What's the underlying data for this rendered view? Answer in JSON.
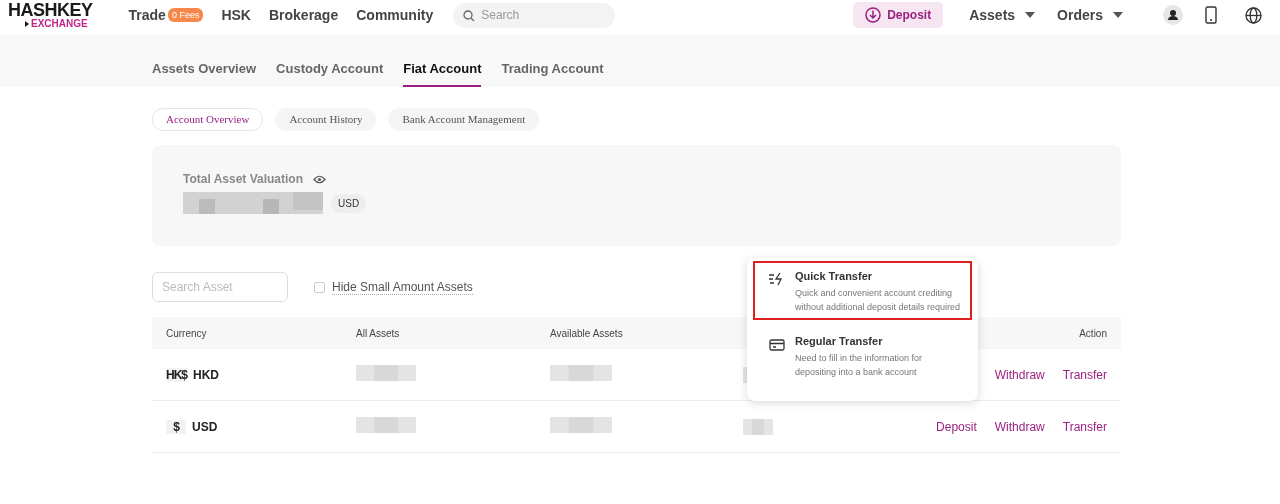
{
  "header": {
    "logo": {
      "title": "HASHKEY",
      "subtitle": "EXCHANGE"
    },
    "nav": [
      {
        "label": "Trade",
        "badge": "0 Fees"
      },
      {
        "label": "HSK"
      },
      {
        "label": "Brokerage"
      },
      {
        "label": "Community"
      }
    ],
    "search": {
      "placeholder": "Search"
    },
    "deposit_button": "Deposit",
    "menus": [
      "Assets",
      "Orders"
    ]
  },
  "account_tabs": [
    {
      "label": "Assets Overview",
      "selected": false
    },
    {
      "label": "Custody Account",
      "selected": false
    },
    {
      "label": "Fiat Account",
      "selected": true
    },
    {
      "label": "Trading Account",
      "selected": false
    }
  ],
  "sub_tabs": [
    {
      "label": "Account Overview",
      "selected": true
    },
    {
      "label": "Account History",
      "selected": false
    },
    {
      "label": "Bank Account Management",
      "selected": false
    }
  ],
  "valuation": {
    "label": "Total Asset Valuation",
    "currency": "USD"
  },
  "filters": {
    "search": {
      "placeholder": "Search Asset"
    },
    "hide_small": {
      "label": "Hide Small Amount Assets",
      "checked": false
    }
  },
  "table": {
    "columns": [
      "Currency",
      "All Assets",
      "Available Assets",
      "Action"
    ],
    "rows": [
      {
        "icon_text": "HK$",
        "symbol": "HKD",
        "actions": [
          "Withdraw",
          "Transfer"
        ]
      },
      {
        "icon_text": "$",
        "symbol": "USD",
        "actions": [
          "Deposit",
          "Withdraw",
          "Transfer"
        ]
      }
    ]
  },
  "transfer_menu": {
    "items": [
      {
        "kind": "quick",
        "title": "Quick Transfer",
        "description": "Quick and convenient account crediting without additional deposit details required",
        "highlighted": true
      },
      {
        "kind": "regular",
        "title": "Regular Transfer",
        "description": "Need to fill in the information for depositing into a bank account",
        "highlighted": false
      }
    ]
  }
}
